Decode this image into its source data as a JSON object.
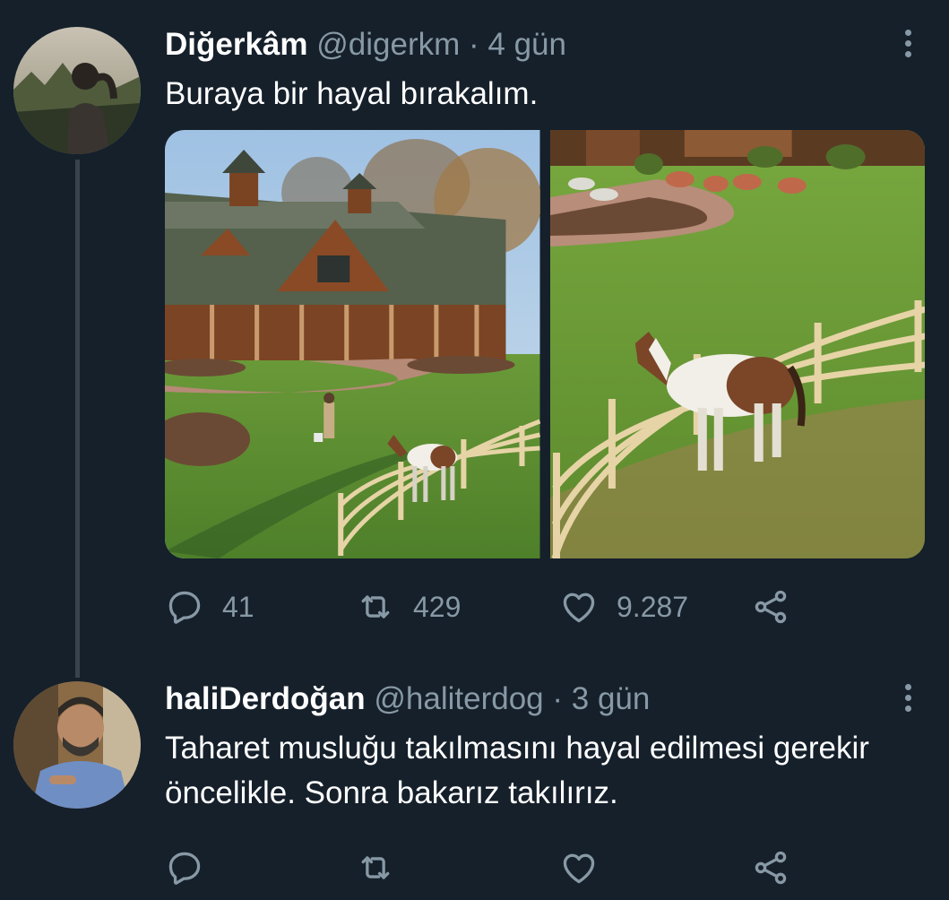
{
  "tweets": [
    {
      "display_name": "Diğerkâm",
      "handle": "@digerkm",
      "separator": "·",
      "time": "4 gün",
      "text": "Buraya bir hayal bırakalım.",
      "media": [
        {
          "description_icon": "barn-ranch-photo"
        },
        {
          "description_icon": "horse-fence-photo"
        }
      ],
      "actions": {
        "reply_count": "41",
        "retweet_count": "429",
        "like_count": "9.287"
      }
    },
    {
      "display_name": "haliDerdoğan",
      "handle": "@haliterdog",
      "separator": "·",
      "time": "3 gün",
      "text": "Taharet musluğu takılmasını hayal edilmesi gerekir öncelikle. Sonra bakarız takılırız.",
      "actions": {
        "reply_count": "",
        "retweet_count": "",
        "like_count": ""
      }
    }
  ],
  "icons": {
    "reply": "reply-icon",
    "retweet": "retweet-icon",
    "like": "heart-icon",
    "share": "share-icon",
    "more": "more-vertical-icon"
  },
  "colors": {
    "background": "#15202b",
    "muted": "#8899a6",
    "text": "#ffffff",
    "thread_line": "#38444d"
  }
}
